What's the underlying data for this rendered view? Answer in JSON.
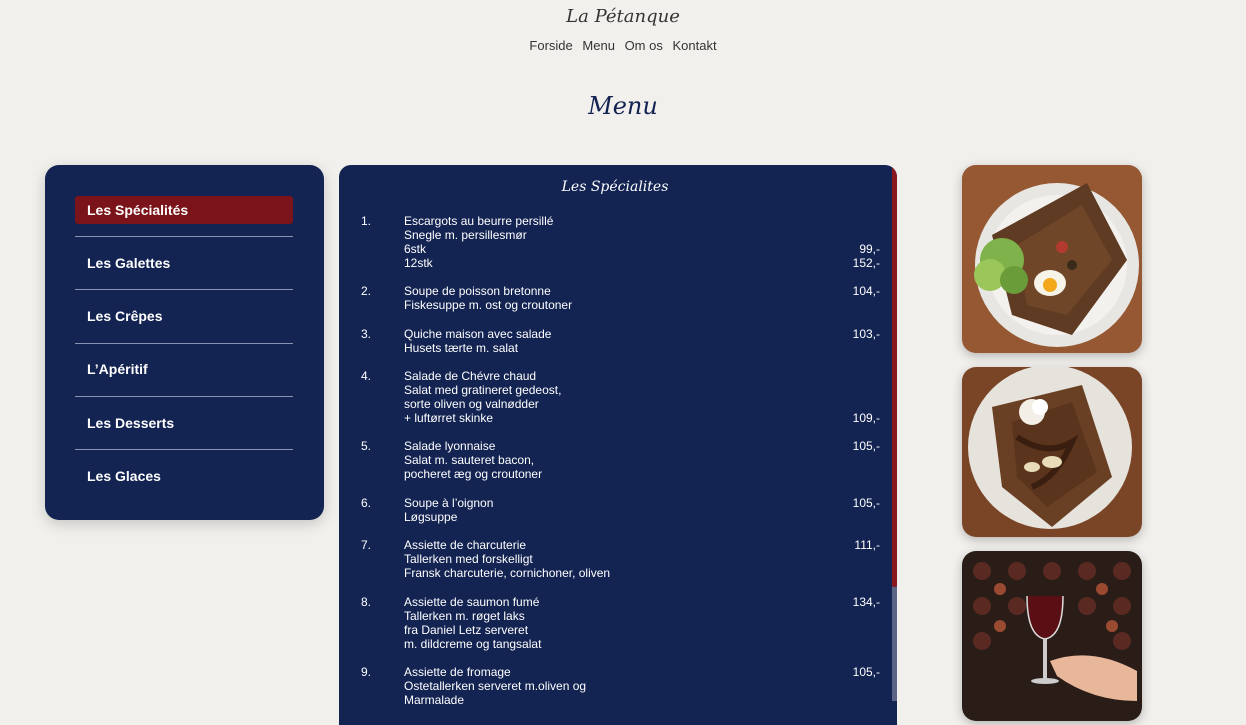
{
  "site": {
    "brand": "La Pétanque"
  },
  "nav": {
    "items": [
      "Forside",
      "Menu",
      "Om os",
      "Kontakt"
    ]
  },
  "page": {
    "title": "Menu"
  },
  "sidebar": {
    "items": [
      {
        "label": "Les Spécialités",
        "active": true
      },
      {
        "label": "Les Galettes"
      },
      {
        "label": "Les Crêpes"
      },
      {
        "label": "L’Apéritif"
      },
      {
        "label": "Les Desserts"
      },
      {
        "label": "Les Glaces"
      }
    ]
  },
  "menu": {
    "heading": "Les Spécialites",
    "items": [
      {
        "num": "1.",
        "lines": [
          "Escargots au beurre persillé",
          "Snegle m. persillesmør",
          "6stk",
          "12stk"
        ],
        "prices": [
          null,
          null,
          "99,-",
          "152,-"
        ]
      },
      {
        "num": "2.",
        "lines": [
          "Soupe de poisson bretonne",
          "Fiskesuppe m. ost og croutoner"
        ],
        "prices": [
          "104,-",
          null
        ]
      },
      {
        "num": "3.",
        "lines": [
          "Quiche maison avec salade",
          "Husets tærte m. salat"
        ],
        "prices": [
          "103,-",
          null
        ]
      },
      {
        "num": "4.",
        "lines": [
          "Salade de Chévre chaud",
          "Salat med gratineret gedeost,",
          "sorte oliven og valnødder",
          "+ luftørret skinke"
        ],
        "prices": [
          null,
          null,
          null,
          "109,-"
        ]
      },
      {
        "num": "5.",
        "lines": [
          "Salade lyonnaise",
          "Salat m. sauteret bacon,",
          "pocheret æg og croutoner"
        ],
        "prices": [
          "105,-",
          null,
          null
        ]
      },
      {
        "num": "6.",
        "lines": [
          "Soupe à l’oignon",
          "Løgsuppe"
        ],
        "prices": [
          "105,-",
          null
        ]
      },
      {
        "num": "7.",
        "lines": [
          "Assiette de charcuterie",
          "Tallerken med forskelligt",
          "Fransk charcuterie, cornichoner, oliven"
        ],
        "prices": [
          "111,-",
          null,
          null
        ]
      },
      {
        "num": "8.",
        "lines": [
          "Assiette de saumon fumé",
          "Tallerken m. røget laks",
          "fra Daniel Letz serveret",
          "m. dildcreme og tangsalat"
        ],
        "prices": [
          "134,-",
          null,
          null,
          null
        ]
      },
      {
        "num": "9.",
        "lines": [
          "Assiette de fromage",
          "Ostetallerken serveret m.oliven og",
          "Marmalade"
        ],
        "prices": [
          "105,-",
          null,
          null
        ]
      }
    ]
  },
  "colors": {
    "navy": "#132352",
    "accent": "#7b141a",
    "background": "#f2f0ec"
  }
}
